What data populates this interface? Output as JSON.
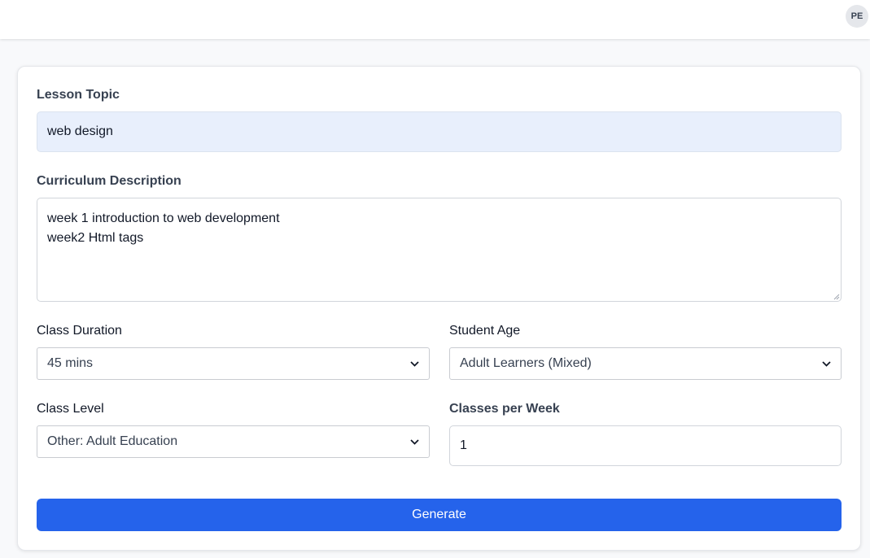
{
  "header": {
    "avatar_initials": "PE"
  },
  "form": {
    "lesson_topic": {
      "label": "Lesson Topic",
      "value": "web design"
    },
    "curriculum_description": {
      "label": "Curriculum Description",
      "value": "week 1 introduction to web development\nweek2 Html tags"
    },
    "class_duration": {
      "label": "Class Duration",
      "selected": "45 mins"
    },
    "student_age": {
      "label": "Student Age",
      "selected": "Adult Learners (Mixed)"
    },
    "class_level": {
      "label": "Class Level",
      "selected": "Other: Adult Education"
    },
    "classes_per_week": {
      "label": "Classes per Week",
      "value": "1"
    },
    "generate_label": "Generate"
  },
  "colors": {
    "primary": "#2563eb",
    "filled_input": "#e8effc",
    "page_background": "#f8f9fb"
  }
}
